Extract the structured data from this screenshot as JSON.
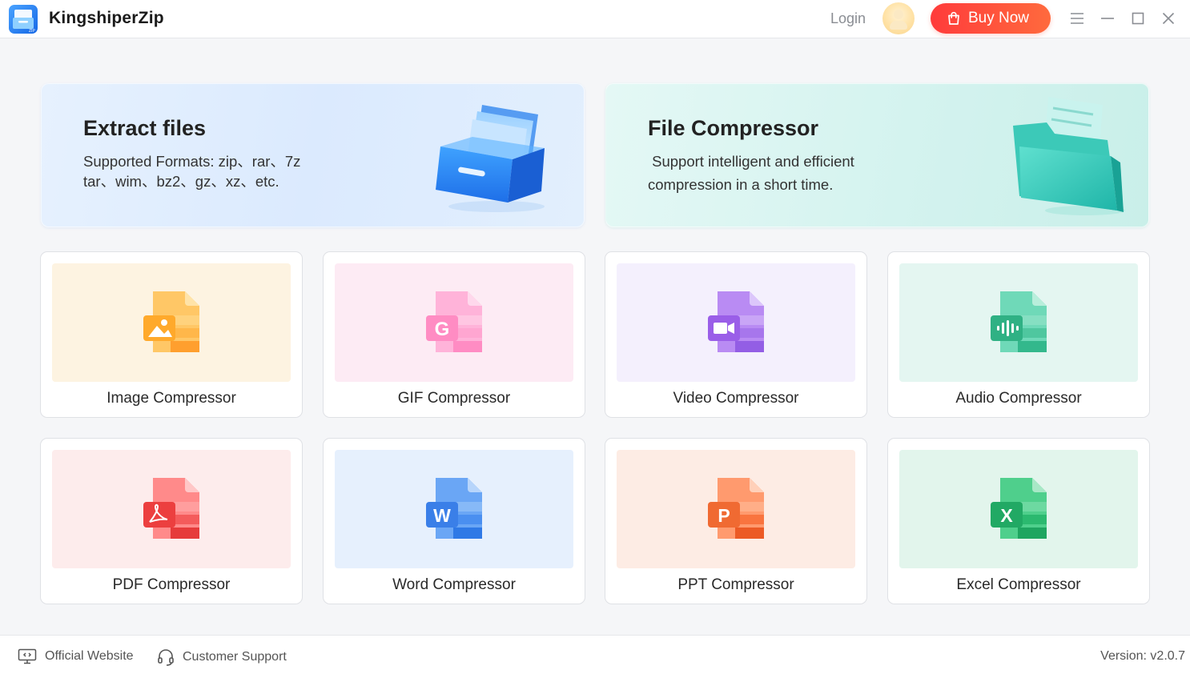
{
  "app": {
    "title": "KingshiperZip"
  },
  "header": {
    "login_label": "Login",
    "buy_label": "Buy Now"
  },
  "banners": {
    "extract": {
      "title": "Extract files",
      "desc_line1": "Supported Formats: zip、rar、7z",
      "desc_line2": "tar、wim、bz2、gz、xz、etc."
    },
    "compress": {
      "title": "File Compressor",
      "desc_line1": " Support intelligent and efficient",
      "desc_line2": "compression in a short time."
    }
  },
  "tools": [
    {
      "label": "Image Compressor",
      "glyph": "",
      "icon": "image-file-icon"
    },
    {
      "label": "GIF Compressor",
      "glyph": "G",
      "icon": "gif-file-icon"
    },
    {
      "label": "Video Compressor",
      "glyph": "",
      "icon": "video-file-icon"
    },
    {
      "label": "Audio Compressor",
      "glyph": "",
      "icon": "audio-file-icon"
    },
    {
      "label": "PDF Compressor",
      "glyph": "",
      "icon": "pdf-file-icon"
    },
    {
      "label": "Word Compressor",
      "glyph": "W",
      "icon": "word-file-icon"
    },
    {
      "label": "PPT Compressor",
      "glyph": "P",
      "icon": "ppt-file-icon"
    },
    {
      "label": "Excel Compressor",
      "glyph": "X",
      "icon": "excel-file-icon"
    }
  ],
  "footer": {
    "website_label": "Official Website",
    "support_label": "Customer Support",
    "version": "Version: v2.0.7"
  },
  "colors": {
    "buy_start": "#ff3b3b",
    "buy_end": "#ff6a3d",
    "image_tile": "#fdf3e1",
    "gif_tile": "#fdebf4",
    "video_tile": "#f4f0fd",
    "audio_tile": "#e4f6f1",
    "pdf_tile": "#fdecec",
    "word_tile": "#e6f0fd",
    "ppt_tile": "#fdece4",
    "excel_tile": "#e2f5ec"
  }
}
